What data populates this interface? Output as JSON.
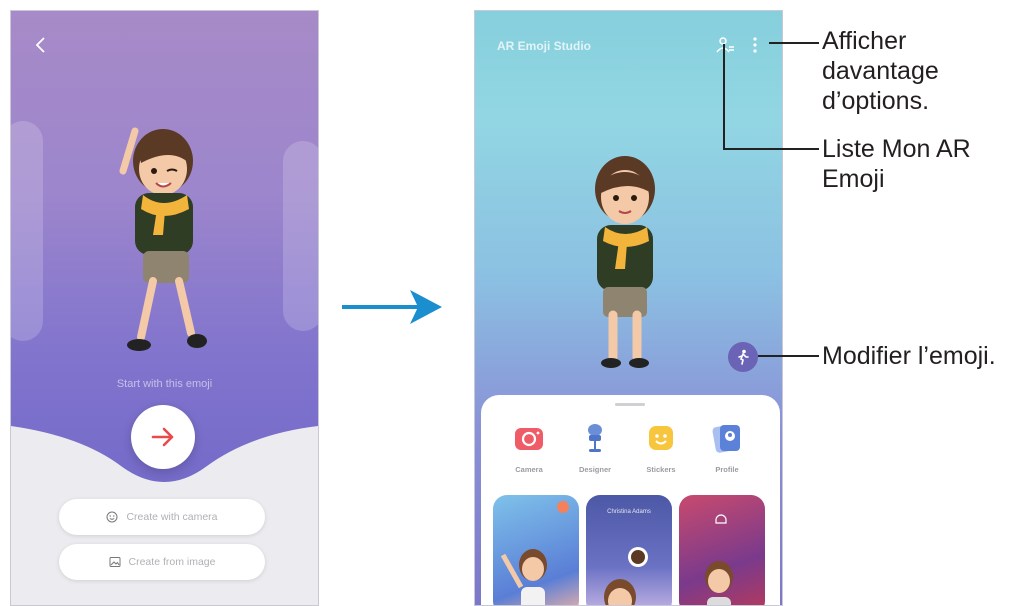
{
  "left_screen": {
    "back_icon": "chevron-left-icon",
    "hint": "Start with this emoji",
    "next_icon": "arrow-right-icon",
    "create_with_camera": "Create with camera",
    "create_from_image": "Create from image"
  },
  "transition_icon": "arrow-right-icon",
  "right_screen": {
    "title": "AR Emoji Studio",
    "icons": {
      "list": "person-list-icon",
      "more": "more-vertical-icon",
      "edit": "person-walk-icon"
    },
    "categories": [
      {
        "label": "Camera",
        "icon": "camera-icon"
      },
      {
        "label": "Designer",
        "icon": "designer-icon"
      },
      {
        "label": "Stickers",
        "icon": "sticker-icon"
      },
      {
        "label": "Profile",
        "icon": "profile-card-icon"
      }
    ],
    "thumbnail_text": "Christina Adams"
  },
  "callouts": {
    "more_options": [
      "Afficher",
      "davantage",
      "d’options."
    ],
    "my_emoji_list": [
      "Liste Mon AR",
      "Emoji"
    ],
    "edit_emoji": "Modifier l’emoji."
  },
  "colors": {
    "left_gradient": [
      "#a78ac8",
      "#6a62c3"
    ],
    "right_gradient": [
      "#86cfdc",
      "#7c78c9"
    ],
    "accent_arrow": "#1b8ecf",
    "button_arrow": "#e84b4b"
  }
}
